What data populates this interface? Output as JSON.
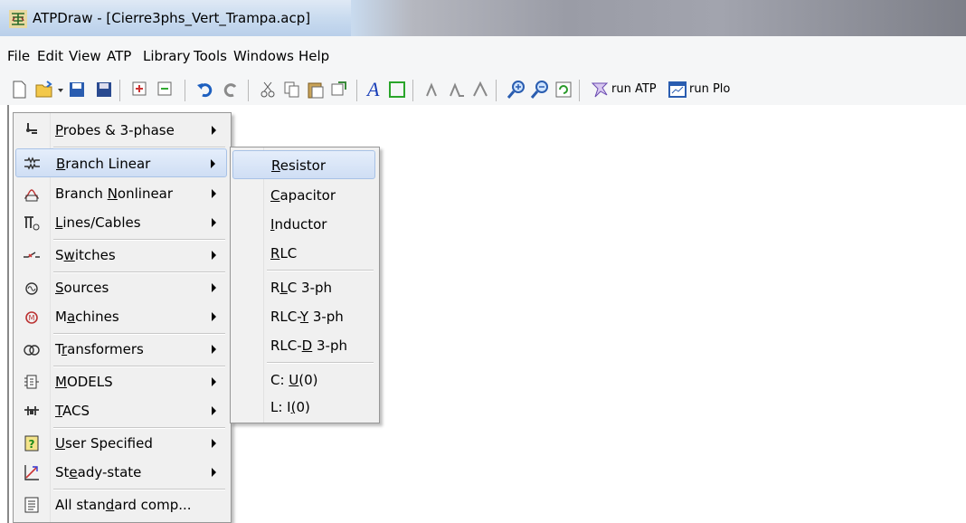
{
  "window": {
    "title": "ATPDraw - [Cierre3phs_Vert_Trampa.acp]"
  },
  "menubar": [
    "File",
    "Edit",
    "View",
    "ATP",
    "Library",
    "Tools",
    "Windows",
    "Help"
  ],
  "toolbar": {
    "run_atp": "run ATP",
    "run_plot": "run Plo"
  },
  "context_menu": [
    {
      "label": "Probes & 3-phase",
      "icon": "probe-icon"
    },
    {
      "label": "Branch Linear",
      "icon": "resistor-branch-icon",
      "highlighted": true
    },
    {
      "label": "Branch Nonlinear",
      "icon": "nonlinear-branch-icon"
    },
    {
      "label": "Lines/Cables",
      "icon": "line-cable-icon"
    },
    {
      "label": "Switches",
      "icon": "switch-icon"
    },
    {
      "label": "Sources",
      "icon": "source-icon"
    },
    {
      "label": "Machines",
      "icon": "machine-icon"
    },
    {
      "label": "Transformers",
      "icon": "transformer-icon"
    },
    {
      "label": "MODELS",
      "icon": "models-icon"
    },
    {
      "label": "TACS",
      "icon": "tacs-icon"
    },
    {
      "label": "User Specified",
      "icon": "user-specified-icon"
    },
    {
      "label": "Steady-state",
      "icon": "steady-state-icon"
    },
    {
      "label": "All standard comp...",
      "icon": "all-components-icon"
    }
  ],
  "submenu": [
    {
      "label": "Resistor",
      "highlighted": true
    },
    {
      "label": "Capacitor"
    },
    {
      "label": "Inductor"
    },
    {
      "label": "RLC"
    },
    {
      "label": "RLC 3-ph"
    },
    {
      "label": "RLC-Y 3-ph"
    },
    {
      "label": "RLC-D 3-ph"
    },
    {
      "label": "C: U(0)"
    },
    {
      "label": "L: I(0)"
    }
  ]
}
